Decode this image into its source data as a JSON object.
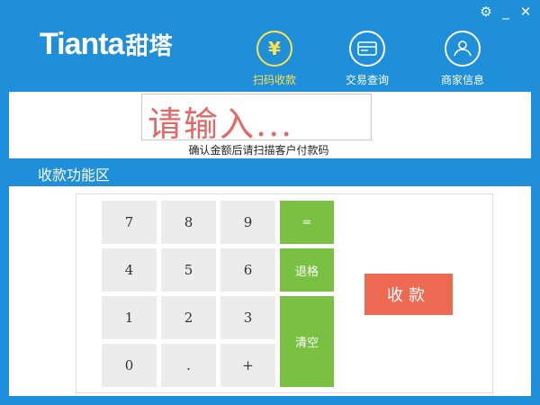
{
  "window": {
    "controls": {
      "settings": "⚙",
      "minimize": "_",
      "close": "✕"
    }
  },
  "brand": {
    "latin": "Tianta",
    "chinese": "甜塔"
  },
  "nav": [
    {
      "label": "扫码收款",
      "icon": "yen-icon",
      "glyph": "¥",
      "active": true
    },
    {
      "label": "交易查询",
      "icon": "card-icon",
      "active": false
    },
    {
      "label": "商家信息",
      "icon": "merchant-icon",
      "active": false
    }
  ],
  "amount": {
    "placeholder": "请输入...",
    "hint": "确认金额后请扫描客户付款码"
  },
  "section": {
    "title": "收款功能区"
  },
  "keypad": {
    "k7": "7",
    "k8": "8",
    "k9": "9",
    "equals": "=",
    "k4": "4",
    "k5": "5",
    "k6": "6",
    "backspace": "退格",
    "k1": "1",
    "k2": "2",
    "k3": "3",
    "clear": "清空",
    "k0": "0",
    "dot": ".",
    "plus": "+"
  },
  "pay_button": "收款",
  "colors": {
    "primary": "#1e8fd8",
    "active_nav": "#ffe14a",
    "accent_green": "#7ac043",
    "pay_red": "#ee6952",
    "input_text": "#e06a66"
  }
}
